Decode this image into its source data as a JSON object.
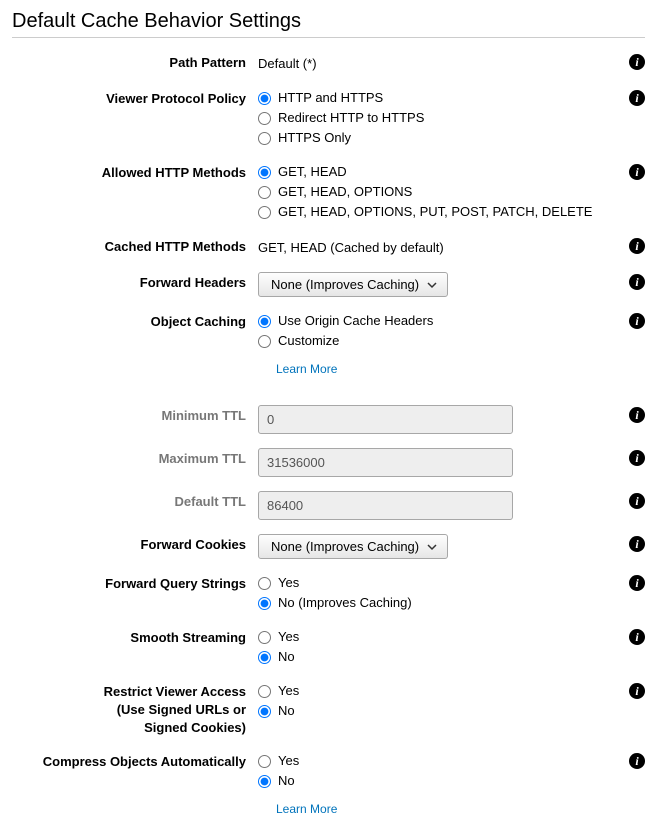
{
  "sectionTitle": "Default Cache Behavior Settings",
  "learnMoreLabel": "Learn More",
  "yes": "Yes",
  "no": "No",
  "noImproves": "No (Improves Caching)",
  "fields": {
    "pathPattern": {
      "label": "Path Pattern",
      "value": "Default (*)"
    },
    "viewerProtocolPolicy": {
      "label": "Viewer Protocol Policy",
      "options": [
        "HTTP and HTTPS",
        "Redirect HTTP to HTTPS",
        "HTTPS Only"
      ],
      "selected": 0
    },
    "allowedHttpMethods": {
      "label": "Allowed HTTP Methods",
      "options": [
        "GET, HEAD",
        "GET, HEAD, OPTIONS",
        "GET, HEAD, OPTIONS, PUT, POST, PATCH, DELETE"
      ],
      "selected": 0
    },
    "cachedHttpMethods": {
      "label": "Cached HTTP Methods",
      "value": "GET, HEAD (Cached by default)"
    },
    "forwardHeaders": {
      "label": "Forward Headers",
      "selected": "None (Improves Caching)"
    },
    "objectCaching": {
      "label": "Object Caching",
      "options": [
        "Use Origin Cache Headers",
        "Customize"
      ],
      "selected": 0
    },
    "minimumTtl": {
      "label": "Minimum TTL",
      "value": "0"
    },
    "maximumTtl": {
      "label": "Maximum TTL",
      "value": "31536000"
    },
    "defaultTtl": {
      "label": "Default TTL",
      "value": "86400"
    },
    "forwardCookies": {
      "label": "Forward Cookies",
      "selected": "None (Improves Caching)"
    },
    "forwardQueryStrings": {
      "label": "Forward Query Strings",
      "selected": 1
    },
    "smoothStreaming": {
      "label": "Smooth Streaming",
      "selected": 1
    },
    "restrictViewerAccess": {
      "label": "Restrict Viewer Access\n(Use Signed URLs or\nSigned Cookies)",
      "selected": 1
    },
    "compressObjects": {
      "label": "Compress Objects Automatically",
      "selected": 1
    }
  }
}
